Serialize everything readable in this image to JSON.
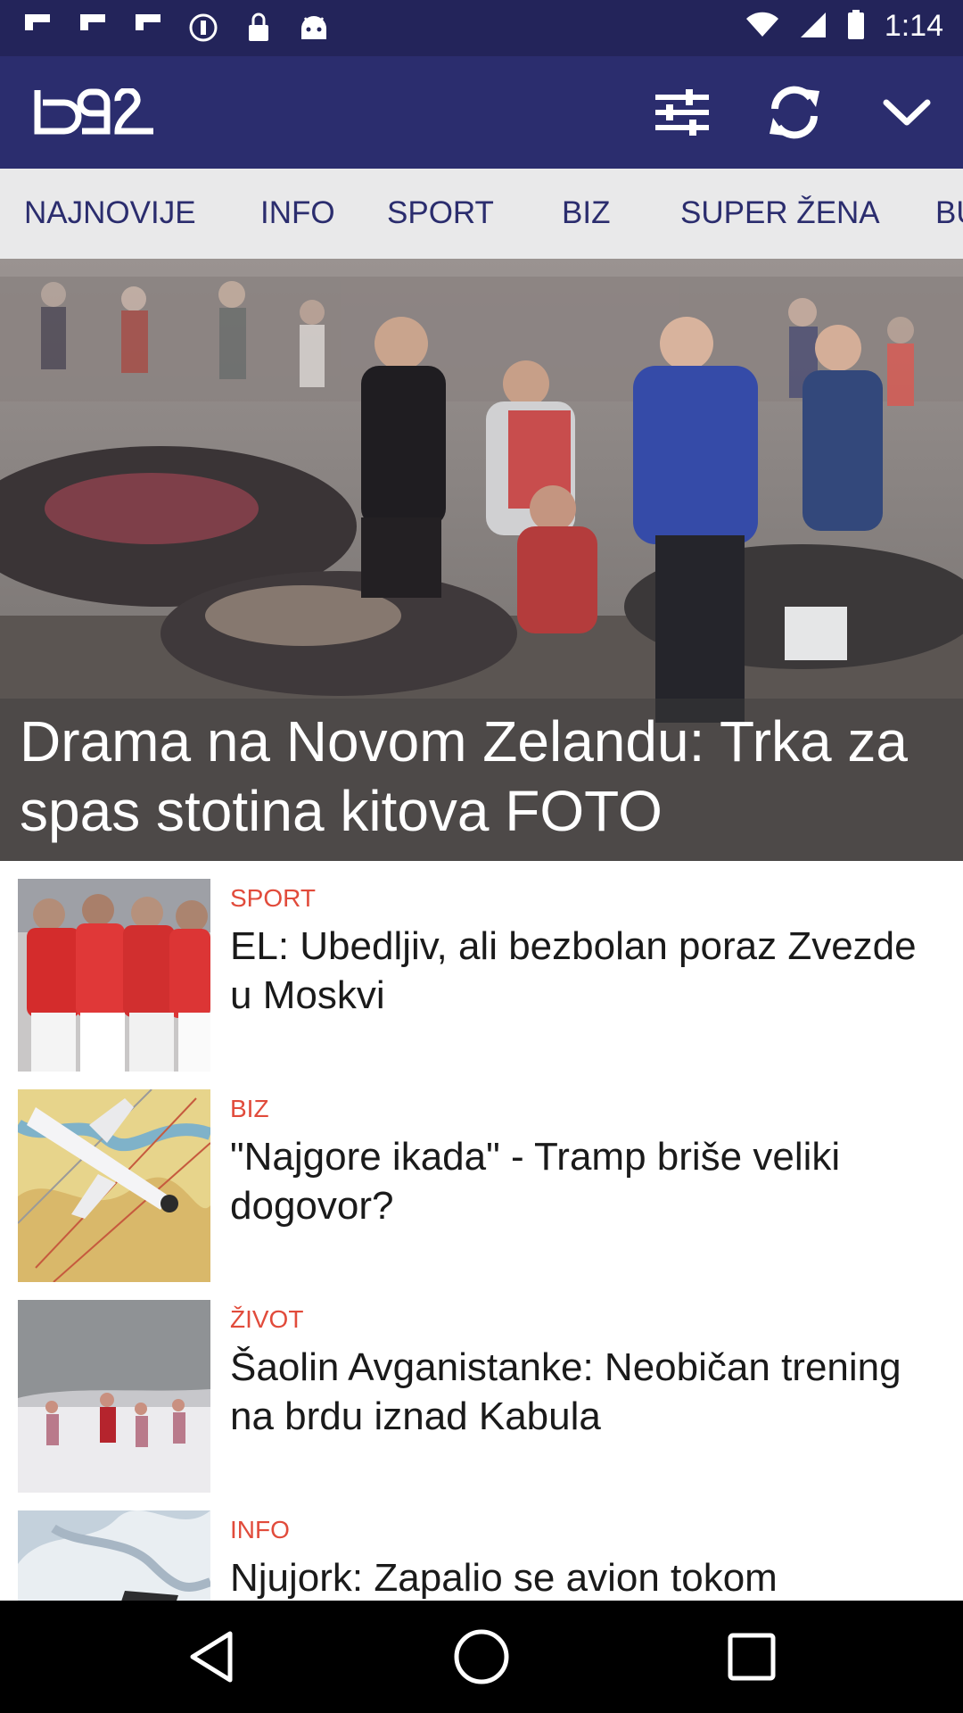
{
  "status_bar": {
    "time": "1:14",
    "icons": [
      "flipboard-icon",
      "flipboard-icon",
      "flipboard-icon",
      "dnd-icon",
      "lock-icon",
      "android-icon"
    ]
  },
  "app_bar": {
    "logo": "b92",
    "actions": [
      "equalizer-icon",
      "refresh-icon",
      "chevron-down-icon"
    ]
  },
  "tabs": [
    "NAJNOVIJE",
    "INFO",
    "SPORT",
    "BIZ",
    "SUPER ŽENA",
    "BU"
  ],
  "hero": {
    "title": "Drama na Novom Zelandu: Trka za spas stotina kitova FOTO"
  },
  "articles": [
    {
      "category": "SPORT",
      "headline": "EL: Ubedljiv, ali bezbolan poraz Zvezde u Moskvi"
    },
    {
      "category": "BIZ",
      "headline": "\"Najgore ikada\" - Tramp briše veliki dogovor?"
    },
    {
      "category": "ŽIVOT",
      "headline": "Šaolin Avganistanke: Neobičan trening na brdu iznad Kabula"
    },
    {
      "category": "INFO",
      "headline": "Njujork: Zapalio se avion tokom"
    }
  ],
  "colors": {
    "status_bar": "#23245a",
    "app_bar": "#2b2d6e",
    "tab_bg": "#e9e9ea",
    "category": "#e14b3b"
  }
}
